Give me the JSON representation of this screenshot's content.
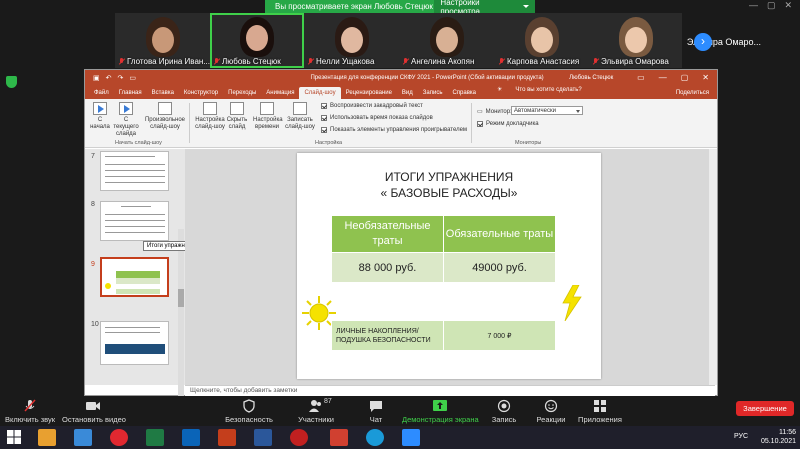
{
  "banner": {
    "text": "Вы просматриваете экран Любовь Стецюк",
    "options": "Настройки просмотра"
  },
  "participants": [
    {
      "name": "Глотова Ирина Иван...",
      "color": "#6b4a3a"
    },
    {
      "name": "Любовь Стецюк",
      "color": "#4a2e2a"
    },
    {
      "name": "Нелли Ущакова",
      "color": "#3a2a2a"
    },
    {
      "name": "Ангелина Акопян",
      "color": "#5a4838"
    },
    {
      "name": "Карпова Анастасия",
      "color": "#8a7060"
    },
    {
      "name": "Эльвира Омарова",
      "color": "#9a8070"
    }
  ],
  "sidebar_user": {
    "name": "Эльвира Омаро..."
  },
  "ppt": {
    "doc_title": "Презентация для конференции СКФУ 2021 - PowerPoint (Сбой активации продукта)",
    "user": "Любовь Стецюк",
    "tabs": [
      "Файл",
      "Главная",
      "Вставка",
      "Конструктор",
      "Переходы",
      "Анимация",
      "Слайд-шоу",
      "Рецензирование",
      "Вид",
      "Запись",
      "Справка"
    ],
    "active_tab": "Слайд-шоу",
    "search": "Что вы хотите сделать?",
    "share": "Поделиться",
    "ribbon": {
      "from_start": "С начала",
      "from_current": "С текущего слайда",
      "custom": "Произвольное слайд-шоу",
      "group1": "Начать слайд-шоу",
      "setup": "Настройка слайд-шоу",
      "hide": "Скрыть слайд",
      "rehearse": "Настройка времени",
      "record": "Записать слайд-шоу",
      "chk1": "Воспроизвести закадровый текст",
      "chk2": "Использовать время показа слайдов",
      "chk3": "Показать элементы управления проигрывателем",
      "group2": "Настройка",
      "monitor_lbl": "Монитор:",
      "monitor_val": "Автоматически",
      "presenter": "Режим докладчика",
      "group3": "Мониторы"
    },
    "thumb_nums": [
      "7",
      "8",
      "9",
      "10"
    ],
    "tooltip": "Итоги упражнения « Базовые рас...",
    "slide": {
      "title1": "ИТОГИ УПРАЖНЕНИЯ",
      "title2": "« БАЗОВЫЕ РАСХОДЫ»",
      "col1": "Необязательные траты",
      "col2": "Обязательные траты",
      "val1": "88 000 руб.",
      "val2": "49000 руб.",
      "savings": "ЛИЧНЫЕ НАКОПЛЕНИЯ/ ПОДУШКА БЕЗОПАСНОСТИ",
      "savings_val": "7 000 ₽"
    },
    "notes": "Щелкните, чтобы добавить заметки"
  },
  "toolbar": {
    "mute": "Включить звук",
    "video": "Остановить видео",
    "security": "Безопасность",
    "participants": "Участники",
    "participants_count": "87",
    "chat": "Чат",
    "share": "Демонстрация экрана",
    "record": "Запись",
    "reactions": "Реакции",
    "apps": "Приложения",
    "end": "Завершение"
  },
  "taskbar": {
    "lang": "РУС",
    "time": "11:56",
    "date": "05.10.2021"
  }
}
